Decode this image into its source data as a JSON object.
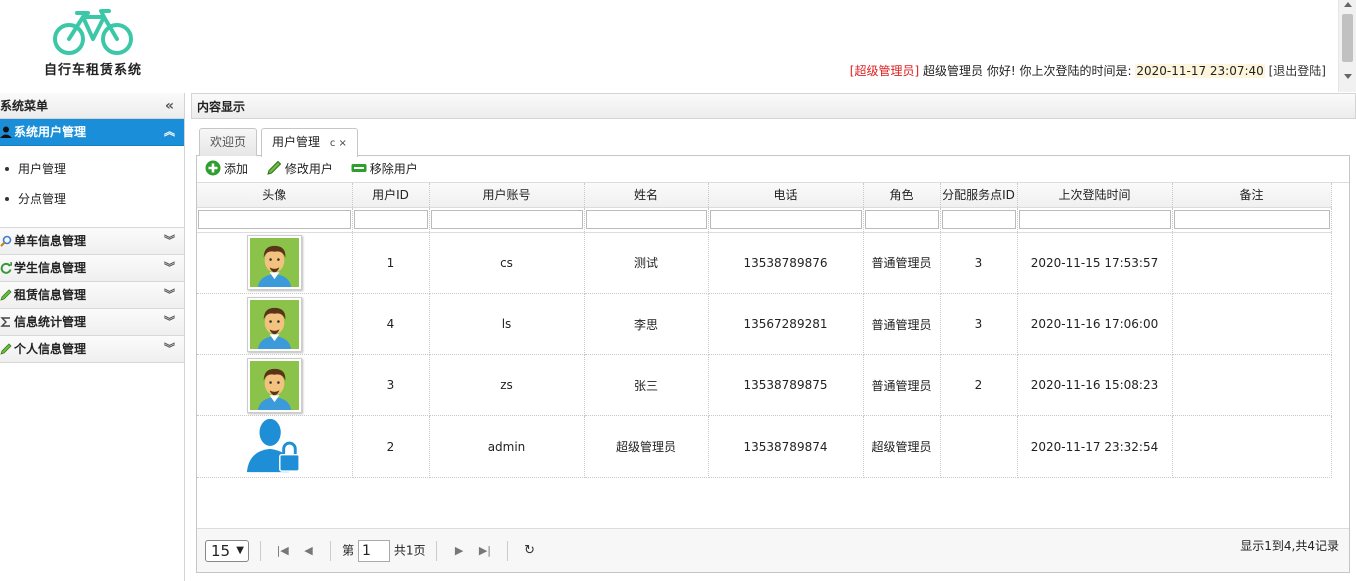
{
  "header": {
    "app_title": "自行车租赁系统",
    "role_tag": "[超级管理员]",
    "user_name": "超级管理员",
    "greeting": "你好! 你上次登陆的时间是:",
    "last_login": "2020-11-17 23:07:40",
    "logout": "[退出登陆]"
  },
  "sidebar": {
    "title": "系统菜单",
    "collapse_icon": "«",
    "active_section": {
      "label": "系统用户管理",
      "items": [
        "用户管理",
        "分点管理"
      ]
    },
    "sections": [
      {
        "label": "单车信息管理",
        "icon": "search-icon"
      },
      {
        "label": "学生信息管理",
        "icon": "refresh-icon"
      },
      {
        "label": "租赁信息管理",
        "icon": "pencil-icon"
      },
      {
        "label": "信息统计管理",
        "icon": "sigma-icon"
      },
      {
        "label": "个人信息管理",
        "icon": "pencil-icon"
      }
    ]
  },
  "main": {
    "title": "内容显示",
    "tabs": [
      {
        "label": "欢迎页"
      },
      {
        "label": "用户管理",
        "tools": "c ×"
      }
    ],
    "toolbar": {
      "add": "添加",
      "edit": "修改用户",
      "remove": "移除用户"
    },
    "columns": [
      "头像",
      "用户ID",
      "用户账号",
      "姓名",
      "电话",
      "角色",
      "分配服务点ID",
      "上次登陆时间",
      "备注"
    ],
    "rows": [
      {
        "avatar": "male-avatar",
        "id": "1",
        "account": "cs",
        "name": "测试",
        "phone": "13538789876",
        "role": "普通管理员",
        "point": "3",
        "last": "2020-11-15 17:53:57",
        "note": ""
      },
      {
        "avatar": "male-avatar",
        "id": "4",
        "account": "ls",
        "name": "李思",
        "phone": "13567289281",
        "role": "普通管理员",
        "point": "3",
        "last": "2020-11-16 17:06:00",
        "note": ""
      },
      {
        "avatar": "male-avatar",
        "id": "3",
        "account": "zs",
        "name": "张三",
        "phone": "13538789875",
        "role": "普通管理员",
        "point": "2",
        "last": "2020-11-16 15:08:23",
        "note": ""
      },
      {
        "avatar": "admin-lock-avatar",
        "id": "2",
        "account": "admin",
        "name": "超级管理员",
        "phone": "13538789874",
        "role": "超级管理员",
        "point": "",
        "last": "2020-11-17 23:32:54",
        "note": ""
      }
    ],
    "pager": {
      "page_size": "15",
      "page_prefix": "第",
      "page_value": "1",
      "page_total": "共1页",
      "info": "显示1到4,共4记录"
    }
  },
  "colors": {
    "accent": "#1a8ed8",
    "logo": "#3cc8a8",
    "role_red": "#dd2222"
  }
}
